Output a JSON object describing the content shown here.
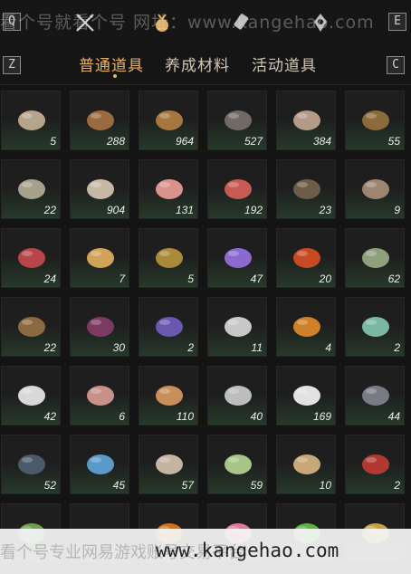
{
  "watermark": {
    "top": "看个号就看个号 网址：www.kangehao.com",
    "bottom_left": "看个号专业网易游戏账号交易平台",
    "bottom_url": "www.kangehao.com"
  },
  "topbar": {
    "left_key": "Q",
    "right_key": "E"
  },
  "tabs": {
    "prev_key": "Z",
    "next_key": "C",
    "items": [
      "普通道具",
      "养成材料",
      "活动道具"
    ]
  },
  "items": [
    {
      "count": "5",
      "icon": "wood-logs-icon",
      "color": "#b7a48c"
    },
    {
      "count": "288",
      "icon": "fur-pelt-icon",
      "color": "#9a6b3e"
    },
    {
      "count": "964",
      "icon": "fur-pelt-icon",
      "color": "#a6783f"
    },
    {
      "count": "527",
      "icon": "feather-icon",
      "color": "#6f6a66"
    },
    {
      "count": "384",
      "icon": "mushrooms-icon",
      "color": "#b49a88"
    },
    {
      "count": "55",
      "icon": "insect-icon",
      "color": "#8c6a3a"
    },
    {
      "count": "22",
      "icon": "fish-icon",
      "color": "#a7a08a"
    },
    {
      "count": "904",
      "icon": "mushroom-icon",
      "color": "#c7b8a6"
    },
    {
      "count": "131",
      "icon": "meat-chunks-icon",
      "color": "#d9938c"
    },
    {
      "count": "192",
      "icon": "raw-meat-icon",
      "color": "#c75a55"
    },
    {
      "count": "23",
      "icon": "feathers-icon",
      "color": "#6d5c48"
    },
    {
      "count": "9",
      "icon": "hide-icon",
      "color": "#9c8672"
    },
    {
      "count": "24",
      "icon": "steak-icon",
      "color": "#b8454a"
    },
    {
      "count": "7",
      "icon": "golden-fish-icon",
      "color": "#d1a35a"
    },
    {
      "count": "5",
      "icon": "ore-icon",
      "color": "#a88a3a"
    },
    {
      "count": "47",
      "icon": "amethyst-icon",
      "color": "#8b6ad0"
    },
    {
      "count": "20",
      "icon": "red-gem-icon",
      "color": "#c84a22"
    },
    {
      "count": "62",
      "icon": "herb-flower-icon",
      "color": "#8fa07a"
    },
    {
      "count": "22",
      "icon": "mortar-bowl-icon",
      "color": "#8a6a40"
    },
    {
      "count": "30",
      "icon": "purple-flower-icon",
      "color": "#7a3a62"
    },
    {
      "count": "2",
      "icon": "lavender-icon",
      "color": "#6a58b0"
    },
    {
      "count": "11",
      "icon": "white-flower-icon",
      "color": "#c8c8c8"
    },
    {
      "count": "4",
      "icon": "orange-flower-icon",
      "color": "#d0802a"
    },
    {
      "count": "2",
      "icon": "jade-stone-icon",
      "color": "#7ab8a2"
    },
    {
      "count": "42",
      "icon": "white-feather-icon",
      "color": "#d8d8d8"
    },
    {
      "count": "6",
      "icon": "pink-pelt-icon",
      "color": "#c79088"
    },
    {
      "count": "110",
      "icon": "tawny-fur-icon",
      "color": "#c88f5a"
    },
    {
      "count": "40",
      "icon": "quills-icon",
      "color": "#bdbdbd"
    },
    {
      "count": "169",
      "icon": "white-fur-icon",
      "color": "#e2e2e2"
    },
    {
      "count": "44",
      "icon": "dark-ore-icon",
      "color": "#7a7a84"
    },
    {
      "count": "52",
      "icon": "black-stone-icon",
      "color": "#4a5a6a"
    },
    {
      "count": "45",
      "icon": "blue-crystal-icon",
      "color": "#5a9ac8"
    },
    {
      "count": "57",
      "icon": "bone-icon",
      "color": "#c4b4a0"
    },
    {
      "count": "59",
      "icon": "green-gourd-icon",
      "color": "#a8c48a"
    },
    {
      "count": "10",
      "icon": "grain-sacks-icon",
      "color": "#c8a878"
    },
    {
      "count": "2",
      "icon": "red-berry-branch-icon",
      "color": "#b03a32"
    },
    {
      "count": "",
      "icon": "green-sprout-icon",
      "color": "#6aa04a"
    },
    {
      "count": "",
      "icon": "empty-slot-icon",
      "color": "#2a2a2a"
    },
    {
      "count": "",
      "icon": "orange-fruit-icon",
      "color": "#d0701a"
    },
    {
      "count": "",
      "icon": "pink-blossom-icon",
      "color": "#e07898"
    },
    {
      "count": "",
      "icon": "green-ball-icon",
      "color": "#5ab040"
    },
    {
      "count": "",
      "icon": "golden-ore-icon",
      "color": "#c8a040"
    }
  ]
}
